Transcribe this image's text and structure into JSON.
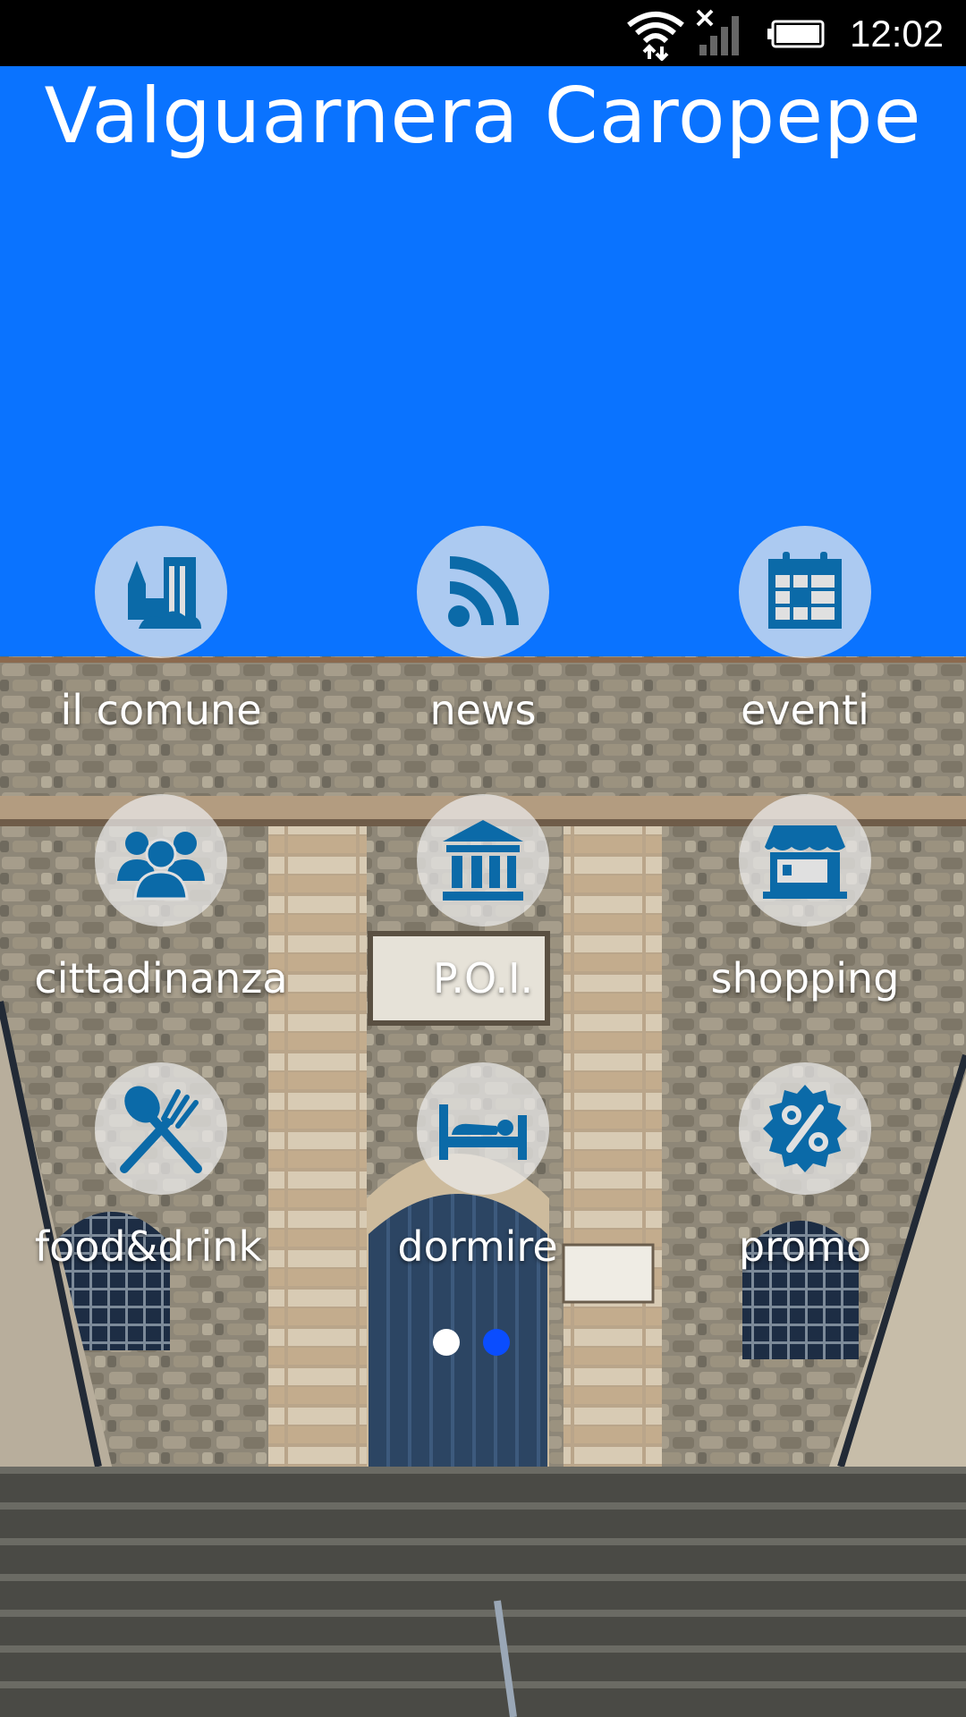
{
  "status_bar": {
    "time": "12:02",
    "icons": [
      "wifi-icon",
      "signal-icon",
      "battery-icon"
    ]
  },
  "app": {
    "title": "Valguarnera Caropepe"
  },
  "colors": {
    "header_blue": "#0a73ff",
    "icon_blue": "#0b6aa8",
    "icon_circle": "#ebebeb",
    "active_dot": "#0a4dff"
  },
  "menu": {
    "items": [
      {
        "label": "il comune",
        "icon": "town-hall-icon"
      },
      {
        "label": "news",
        "icon": "rss-icon"
      },
      {
        "label": "eventi",
        "icon": "calendar-icon"
      },
      {
        "label": "cittadinanza",
        "icon": "people-icon"
      },
      {
        "label": "P.O.I.",
        "icon": "museum-icon"
      },
      {
        "label": "shopping",
        "icon": "shop-icon"
      },
      {
        "label": "food&drink",
        "icon": "cutlery-icon"
      },
      {
        "label": "dormire",
        "icon": "bed-icon"
      },
      {
        "label": "promo",
        "icon": "percent-badge-icon"
      }
    ]
  },
  "pager": {
    "page_count": 2,
    "active_index": 1
  }
}
